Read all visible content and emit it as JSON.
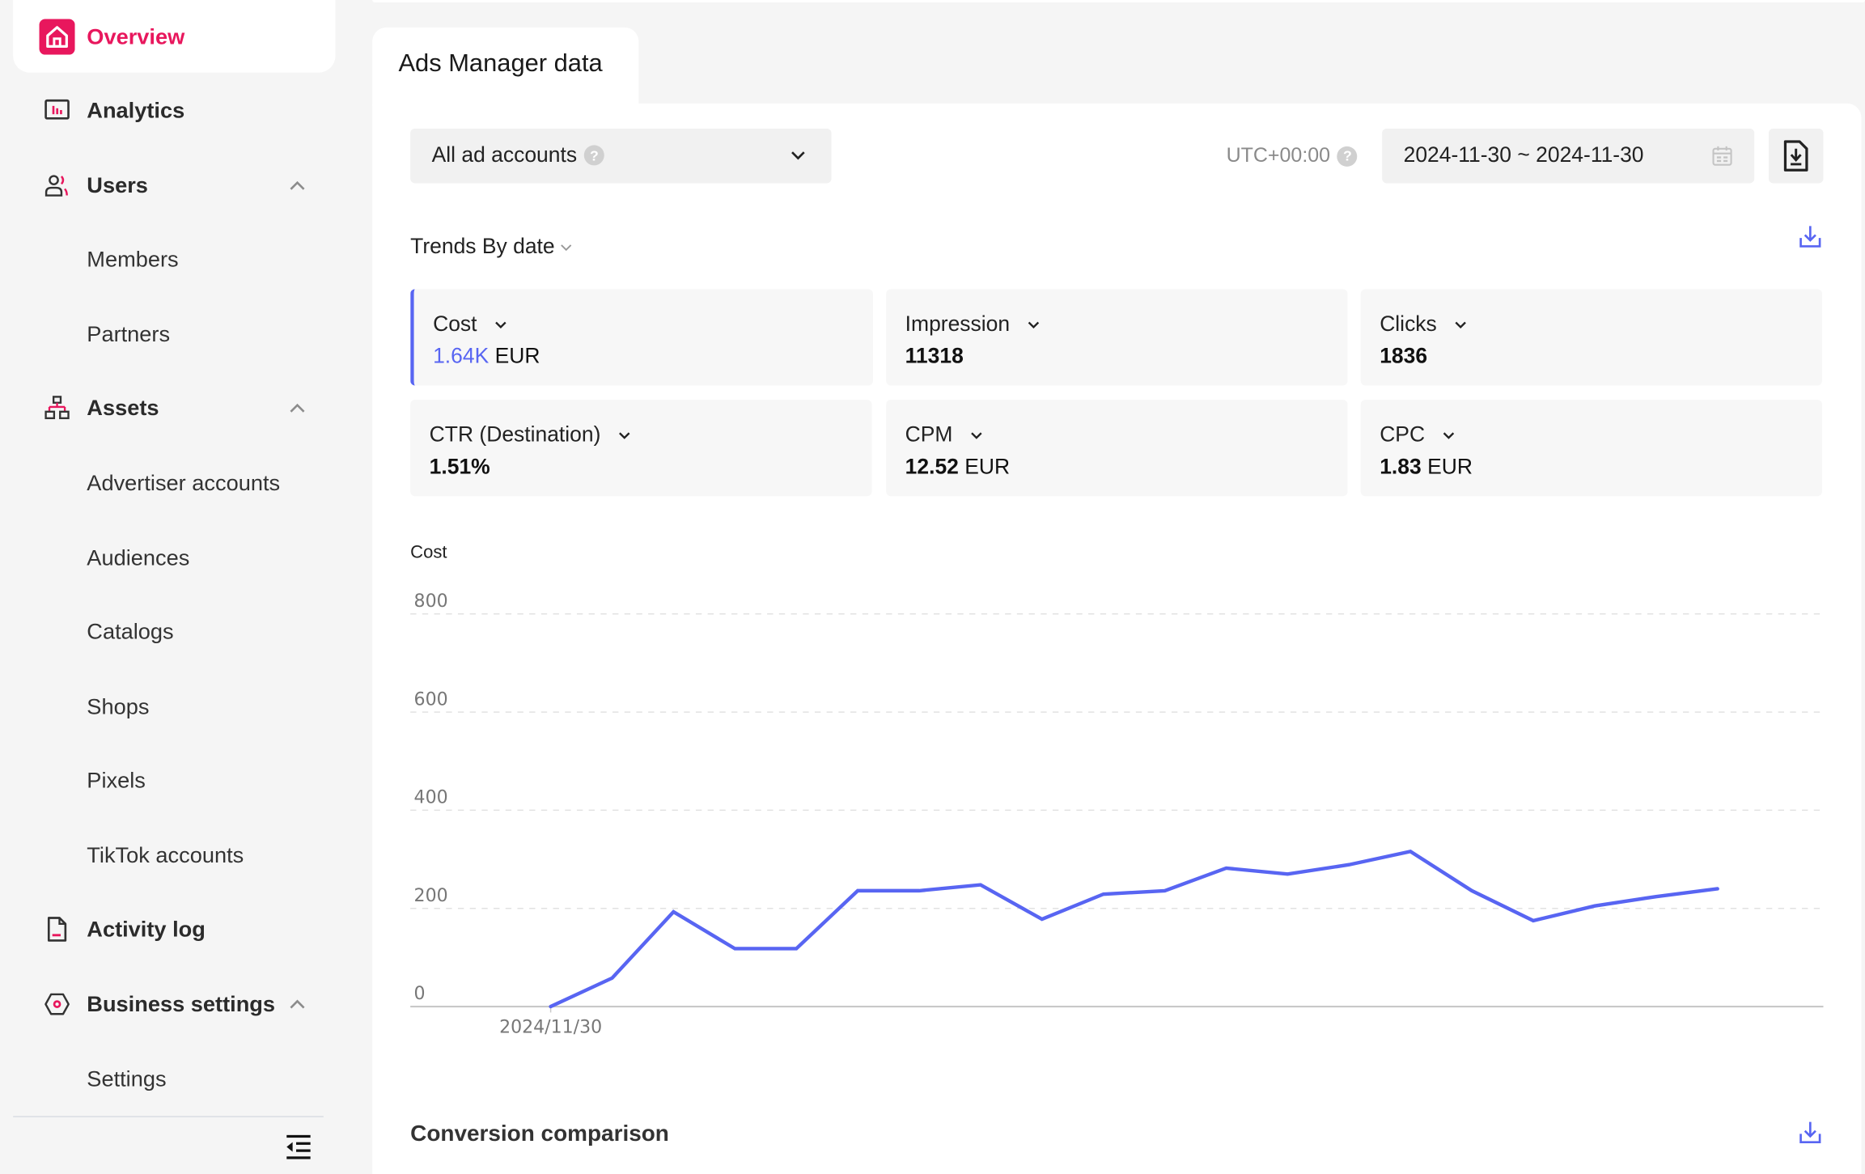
{
  "sidebar": {
    "items": [
      {
        "label": "Overview",
        "icon": "home-icon",
        "active": true
      },
      {
        "label": "Analytics",
        "icon": "bar-chart-icon"
      },
      {
        "label": "Users",
        "icon": "users-icon",
        "expanded": true
      },
      {
        "label": "Members",
        "sub": true
      },
      {
        "label": "Partners",
        "sub": true
      },
      {
        "label": "Assets",
        "icon": "hierarchy-icon",
        "expanded": true
      },
      {
        "label": "Advertiser accounts",
        "sub": true
      },
      {
        "label": "Audiences",
        "sub": true
      },
      {
        "label": "Catalogs",
        "sub": true
      },
      {
        "label": "Shops",
        "sub": true
      },
      {
        "label": "Pixels",
        "sub": true
      },
      {
        "label": "TikTok accounts",
        "sub": true
      },
      {
        "label": "Activity log",
        "icon": "document-icon"
      },
      {
        "label": "Business settings",
        "icon": "hexagon-settings-icon",
        "expanded": true
      },
      {
        "label": "Settings",
        "sub": true
      }
    ],
    "collapse_icon": "collapse-menu-icon"
  },
  "colors": {
    "brand": "#e8175d",
    "accent": "#5865f2",
    "background": "#f5f5f5"
  },
  "main": {
    "tab_title": "Ads Manager data",
    "account_select": {
      "value": "All ad accounts"
    },
    "timezone": "UTC+00:00",
    "date_range": "2024-11-30 ~ 2024-11-30",
    "trends_label": "Trends By date",
    "metrics": [
      {
        "label": "Cost",
        "value": "1.64K",
        "unit": "EUR",
        "selected": true
      },
      {
        "label": "Impression",
        "value": "11318",
        "unit": ""
      },
      {
        "label": "Clicks",
        "value": "1836",
        "unit": ""
      },
      {
        "label": "CTR (Destination)",
        "value": "1.51%",
        "unit": ""
      },
      {
        "label": "CPM",
        "value": "12.52",
        "unit": "EUR"
      },
      {
        "label": "CPC",
        "value": "1.83",
        "unit": "EUR"
      }
    ],
    "conversion_title": "Conversion comparison"
  },
  "chart_data": {
    "type": "line",
    "title": "Cost",
    "ylabel": "Cost",
    "xlabel": "",
    "ylim": [
      0,
      800
    ],
    "yticks": [
      "0",
      "200",
      "400",
      "600",
      "800"
    ],
    "xtick_labels": [
      "2024/11/30"
    ],
    "grid": true,
    "series": [
      {
        "name": "Cost",
        "color": "#5865f2",
        "values": [
          0,
          58,
          193,
          118,
          118,
          236,
          236,
          248,
          178,
          229,
          236,
          282,
          270,
          289,
          316,
          236,
          175,
          205,
          224,
          240
        ]
      }
    ]
  }
}
